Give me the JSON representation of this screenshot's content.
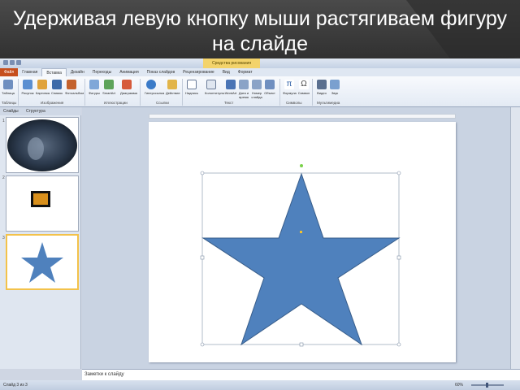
{
  "banner": {
    "caption": "Удерживая левую кнопку мыши растягиваем фигуру на слайде"
  },
  "app": {
    "ribbon_tabs": [
      "Файл",
      "Главная",
      "Вставка",
      "Дизайн",
      "Переходы",
      "Анимация",
      "Показ слайдов",
      "Рецензирование",
      "Вид",
      "Формат"
    ],
    "active_tab_index": 2,
    "contextual_tab_label": "Средства рисования",
    "ribbon_buttons": [
      "Таблица",
      "Рисунок",
      "Картинка",
      "Снимок",
      "Фотоальбом",
      "Фигуры",
      "SmartArt",
      "Диаграмма",
      "Гиперссылка",
      "Действие",
      "Надпись",
      "Колонтитулы",
      "WordArt",
      "Дата и время",
      "Номер слайда",
      "Объект",
      "Формула",
      "Символ",
      "Видео",
      "Звук"
    ],
    "ribbon_groups": [
      "Таблицы",
      "Изображения",
      "Иллюстрации",
      "Ссылки",
      "Текст",
      "Символы",
      "Мультимедиа"
    ],
    "panel_tabs": [
      "Слайды",
      "Структура"
    ],
    "slide_numbers": [
      "1",
      "2",
      "3"
    ],
    "selected_slide": 3,
    "notes_placeholder": "Заметки к слайду",
    "status_text": "Слайд 3 из 3",
    "zoom_label": "60%"
  },
  "colors": {
    "star_fill": "#4f81bd",
    "star_stroke": "#385d8a",
    "selection_accent": "#f3c24a",
    "file_tab": "#c64f1e"
  },
  "icons": [
    "table-icon",
    "picture-icon",
    "shapes-icon",
    "chart-icon",
    "hyperlink-icon",
    "textbox-icon",
    "wordart-icon",
    "formula-icon",
    "symbol-icon",
    "video-icon",
    "audio-icon"
  ]
}
